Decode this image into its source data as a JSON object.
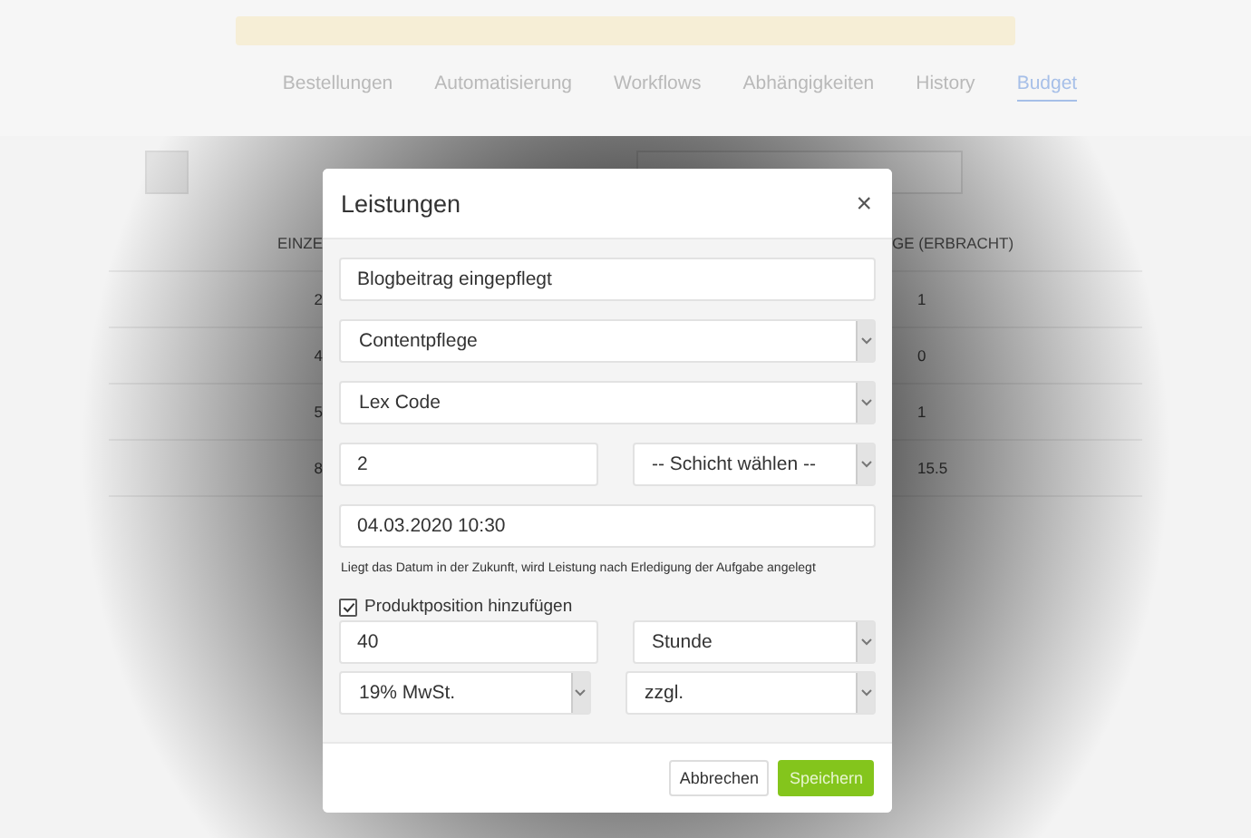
{
  "tabs": [
    {
      "label": "Bestellungen",
      "selected": false
    },
    {
      "label": "Automatisierung",
      "selected": false
    },
    {
      "label": "Workflows",
      "selected": false
    },
    {
      "label": "Abhängigkeiten",
      "selected": false
    },
    {
      "label": "History",
      "selected": false
    },
    {
      "label": "Budget",
      "selected": true
    }
  ],
  "table": {
    "columns": [
      "EINZE",
      "GE (ERBRACHT)"
    ],
    "rows": [
      [
        "2",
        "1"
      ],
      [
        "4",
        "0"
      ],
      [
        "5",
        "1"
      ],
      [
        "8",
        "15.5"
      ]
    ]
  },
  "dialog": {
    "title": "Leistungen",
    "close": "×",
    "rows": [
      [
        {
          "kind": "input",
          "value": "Blogbeitrag eingepflegt"
        }
      ],
      [
        {
          "kind": "select",
          "value": "Contentpflege"
        }
      ],
      [
        {
          "kind": "select",
          "value": "Lex Code"
        }
      ],
      [
        {
          "kind": "input",
          "value": "2"
        },
        {
          "kind": "select",
          "value": "-- Schicht wählen --"
        }
      ],
      [
        {
          "kind": "input",
          "value": "04.03.2020 10:30"
        }
      ]
    ],
    "hint": "Liegt das Datum in der Zukunft, wird Leistung nach Erledigung der Aufgabe angelegt",
    "checkbox": {
      "label": "Produktposition hinzufügen",
      "checked": true
    },
    "product_rows": [
      [
        {
          "kind": "input",
          "value": "40"
        },
        {
          "kind": "select",
          "value": "Stunde"
        }
      ],
      [
        {
          "kind": "select",
          "value": "19% MwSt."
        },
        {
          "kind": "select",
          "value": "zzgl."
        }
      ]
    ],
    "buttons": [
      {
        "label": "Abbrechen",
        "kind": "default"
      },
      {
        "label": "Speichern",
        "kind": "primary"
      }
    ]
  }
}
